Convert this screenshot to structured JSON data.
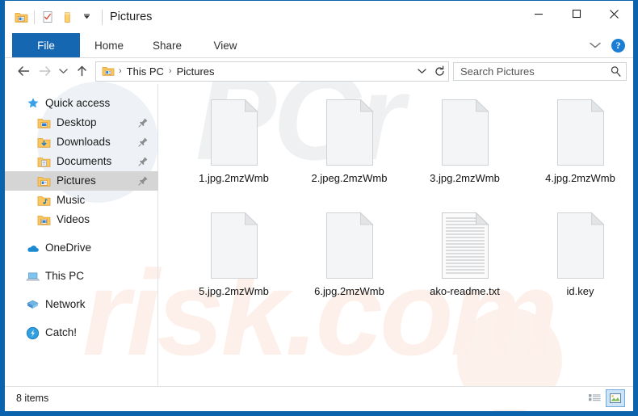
{
  "window": {
    "title": "Pictures",
    "quick_access_icons": [
      "properties-icon",
      "new-folder-icon",
      "folder-icon"
    ],
    "customize_label": "▾",
    "controls": {
      "minimize": "minimize-icon",
      "maximize": "maximize-icon",
      "close": "close-icon"
    },
    "border_color": "#0b63ad"
  },
  "ribbon": {
    "tabs": [
      {
        "label": "File",
        "active": true
      },
      {
        "label": "Home",
        "active": false
      },
      {
        "label": "Share",
        "active": false
      },
      {
        "label": "View",
        "active": false
      }
    ],
    "expand_label": "chevron-down-icon",
    "help_label": "?",
    "accent": "#1667b1"
  },
  "address": {
    "back": "back-arrow-icon",
    "forward": "forward-arrow-icon",
    "recent": "chevron-down-icon",
    "up": "up-arrow-icon",
    "breadcrumbs": [
      "This PC",
      "Pictures"
    ],
    "separator": "›",
    "dropdown": "chevron-down-icon",
    "refresh": "refresh-icon"
  },
  "search": {
    "placeholder": "Search Pictures",
    "value": "",
    "icon": "search-icon"
  },
  "sidebar": {
    "groups": [
      {
        "header": {
          "label": "Quick access",
          "icon": "star-icon"
        },
        "items": [
          {
            "label": "Desktop",
            "icon": "folder-desktop-icon",
            "pinned": true,
            "selected": false
          },
          {
            "label": "Downloads",
            "icon": "folder-downloads-icon",
            "pinned": true,
            "selected": false
          },
          {
            "label": "Documents",
            "icon": "folder-documents-icon",
            "pinned": true,
            "selected": false
          },
          {
            "label": "Pictures",
            "icon": "folder-pictures-icon",
            "pinned": true,
            "selected": true
          },
          {
            "label": "Music",
            "icon": "folder-music-icon",
            "pinned": false,
            "selected": false
          },
          {
            "label": "Videos",
            "icon": "folder-videos-icon",
            "pinned": false,
            "selected": false
          }
        ]
      },
      {
        "header": null,
        "items": [
          {
            "label": "OneDrive",
            "icon": "onedrive-icon",
            "pinned": false,
            "selected": false
          }
        ]
      },
      {
        "header": null,
        "items": [
          {
            "label": "This PC",
            "icon": "this-pc-icon",
            "pinned": false,
            "selected": false
          }
        ]
      },
      {
        "header": null,
        "items": [
          {
            "label": "Network",
            "icon": "network-icon",
            "pinned": false,
            "selected": false
          }
        ]
      },
      {
        "header": null,
        "items": [
          {
            "label": "Catch!",
            "icon": "catch-icon",
            "pinned": false,
            "selected": false
          }
        ]
      }
    ]
  },
  "files": [
    {
      "name": "1.jpg.2mzWmb",
      "type": "blank"
    },
    {
      "name": "2.jpeg.2mzWmb",
      "type": "blank"
    },
    {
      "name": "3.jpg.2mzWmb",
      "type": "blank"
    },
    {
      "name": "4.jpg.2mzWmb",
      "type": "blank"
    },
    {
      "name": "5.jpg.2mzWmb",
      "type": "blank"
    },
    {
      "name": "6.jpg.2mzWmb",
      "type": "blank"
    },
    {
      "name": "ako-readme.txt",
      "type": "text"
    },
    {
      "name": "id.key",
      "type": "blank"
    }
  ],
  "status": {
    "item_count": "8 items",
    "views": [
      {
        "name": "details-view-button",
        "active": false
      },
      {
        "name": "large-icons-view-button",
        "active": true
      }
    ]
  },
  "watermark": {
    "grey_text": "PCr",
    "pink_text": "risk.com"
  }
}
